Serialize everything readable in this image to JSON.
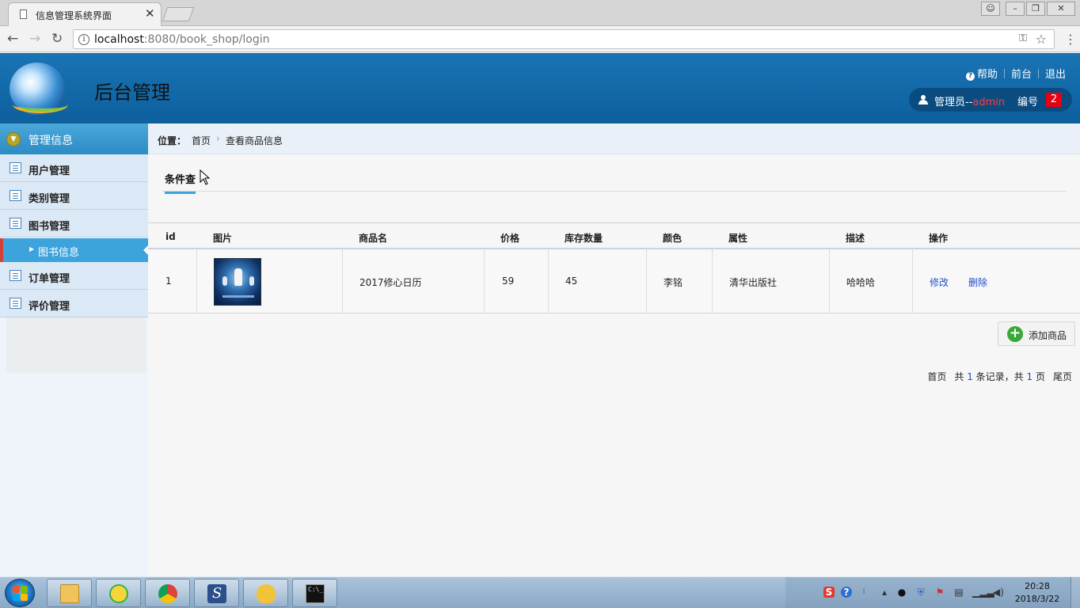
{
  "browser": {
    "tab_title": "信息管理系统界面",
    "url_host": "localhost",
    "url_rest": ":8080/book_shop/login"
  },
  "header": {
    "app_title": "后台管理",
    "help": "帮助",
    "frontend": "前台",
    "logout": "退出",
    "user_label": "管理员--",
    "user_name": "admin",
    "number_label": "编号",
    "number_value": "2"
  },
  "sidebar": {
    "heading": "管理信息",
    "items": [
      {
        "label": "用户管理"
      },
      {
        "label": "类别管理"
      },
      {
        "label": "图书管理"
      },
      {
        "label": "图书信息"
      },
      {
        "label": "订单管理"
      },
      {
        "label": "评价管理"
      }
    ]
  },
  "breadcrumb": {
    "label": "位置：",
    "home": "首页",
    "current": "查看商品信息"
  },
  "filter_tab": "条件查",
  "table": {
    "headers": [
      "id",
      "图片",
      "商品名",
      "价格",
      "库存数量",
      "颜色",
      "属性",
      "描述",
      "操作"
    ],
    "rows": [
      {
        "id": "1",
        "name": "2017修心日历",
        "price": "59",
        "stock": "45",
        "color": "李铭",
        "attribute": "清华出版社",
        "description": "哈哈哈",
        "edit": "修改",
        "delete": "删除"
      }
    ]
  },
  "add_button": "添加商品",
  "pager": {
    "first": "首页",
    "total_prefix": "共",
    "total_records": "1",
    "records_suffix": "条记录，共",
    "total_pages": "1",
    "pages_suffix": "页",
    "last": "尾页"
  },
  "taskbar": {
    "clock_time": "20:28",
    "clock_date": "2018/3/22"
  },
  "colors": {
    "header_blue": "#0d5f9d",
    "sidebar_active": "#3da3dd",
    "link_blue": "#1e4ec8",
    "badge_red": "#e60012",
    "add_green": "#39a935"
  }
}
